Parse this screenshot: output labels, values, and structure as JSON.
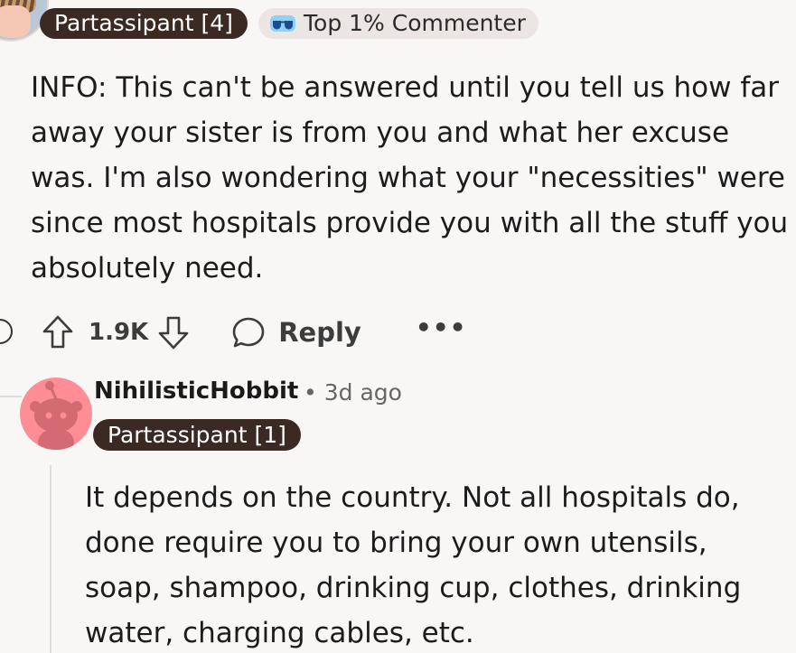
{
  "parent_comment": {
    "author_flair": "Partassipant [4]",
    "achievement_badge": "Top 1% Commenter",
    "body": "INFO: This can't be answered until you tell us how far away your sister is from you and what her excuse was. I'm also wondering what your \"necessities\" were since most hospitals provide you with all the stuff you absolutely need.",
    "vote_count": "1.9K",
    "reply_label": "Reply",
    "more_label": "•••"
  },
  "reply_comment": {
    "username": "NihilisticHobbit",
    "separator": "•",
    "timestamp": "3d ago",
    "author_flair": "Partassipant [1]",
    "body": "It depends on the country. Not all hospitals do, done require you to bring your own utensils, soap, shampoo, drinking cup, clothes, drinking water, charging cables, etc."
  },
  "icons": {
    "upvote": "arrow-up-icon",
    "downvote": "arrow-down-icon",
    "reply": "speech-bubble-icon",
    "more": "ellipsis-icon",
    "badge": "sunglasses-icon",
    "avatar": "snoo-avatar-icon"
  },
  "colors": {
    "background": "#f9f7f6",
    "flair_bg": "#3b2a23",
    "flair_text": "#ffffff",
    "badge_bg": "#ebe6e3",
    "reply_avatar_bg": "#ff8d95",
    "action_text": "#3c3c3c"
  }
}
